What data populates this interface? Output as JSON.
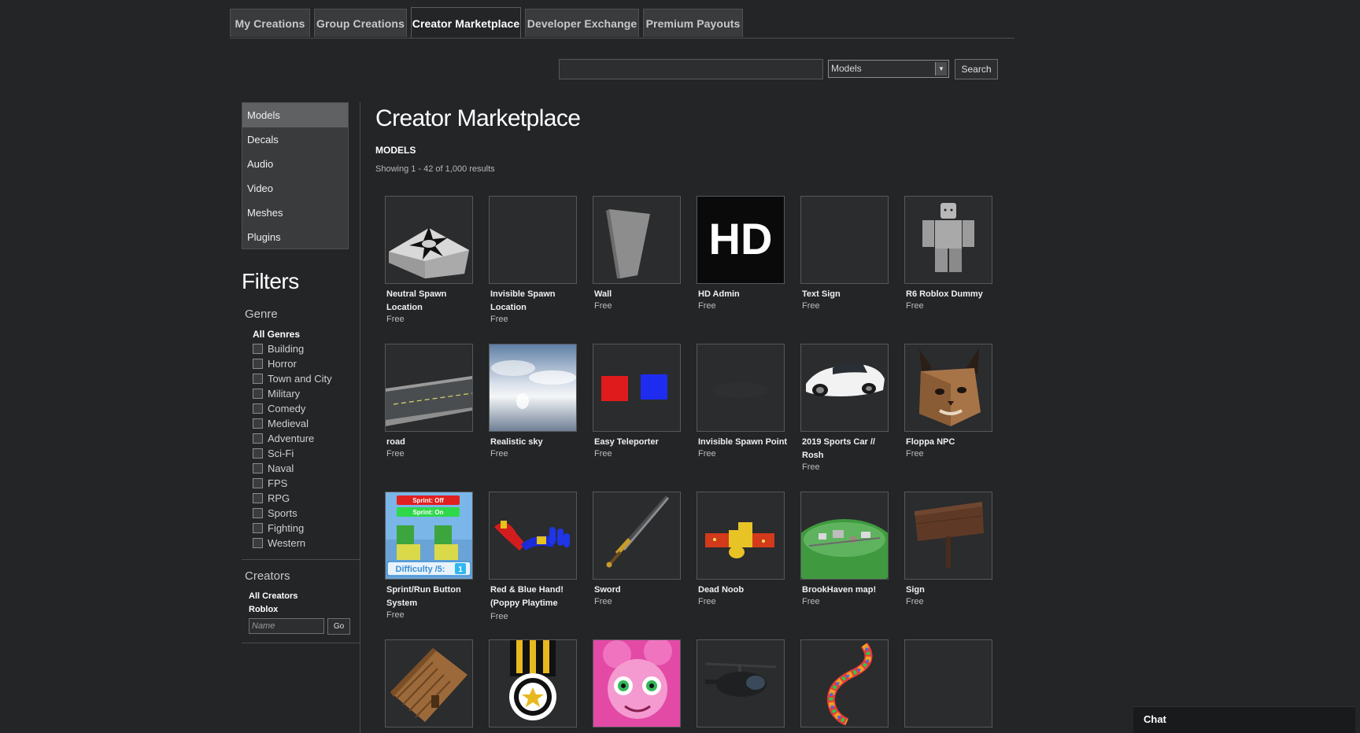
{
  "tabs": [
    {
      "label": "My Creations",
      "active": false
    },
    {
      "label": "Group Creations",
      "active": false
    },
    {
      "label": "Creator Marketplace",
      "active": true
    },
    {
      "label": "Developer Exchange",
      "active": false
    },
    {
      "label": "Premium Payouts",
      "active": false
    }
  ],
  "search": {
    "query": "",
    "category_selected": "Models",
    "button_label": "Search"
  },
  "categories": [
    {
      "label": "Models",
      "active": true
    },
    {
      "label": "Decals",
      "active": false
    },
    {
      "label": "Audio",
      "active": false
    },
    {
      "label": "Video",
      "active": false
    },
    {
      "label": "Meshes",
      "active": false
    },
    {
      "label": "Plugins",
      "active": false
    }
  ],
  "filters": {
    "title": "Filters",
    "genre_title": "Genre",
    "all_genres_label": "All Genres",
    "genres": [
      "Building",
      "Horror",
      "Town and City",
      "Military",
      "Comedy",
      "Medieval",
      "Adventure",
      "Sci-Fi",
      "Naval",
      "FPS",
      "RPG",
      "Sports",
      "Fighting",
      "Western"
    ],
    "creators_title": "Creators",
    "all_creators_label": "All Creators",
    "creator_roblox": "Roblox",
    "name_placeholder": "Name",
    "go_label": "Go"
  },
  "main": {
    "title": "Creator Marketplace",
    "section_label": "MODELS",
    "results_text": "Showing 1 - 42 of 1,000 results"
  },
  "items": [
    {
      "name": "Neutral Spawn Location",
      "price": "Free",
      "thumb": "spawn-pad"
    },
    {
      "name": "Invisible Spawn Location",
      "price": "Free",
      "thumb": "empty"
    },
    {
      "name": "Wall",
      "price": "Free",
      "thumb": "wall"
    },
    {
      "name": "HD Admin",
      "price": "Free",
      "thumb": "hd-logo",
      "thumb_text": "HD"
    },
    {
      "name": "Text Sign",
      "price": "Free",
      "thumb": "empty"
    },
    {
      "name": "R6 Roblox Dummy",
      "price": "Free",
      "thumb": "dummy"
    },
    {
      "name": "road",
      "price": "Free",
      "thumb": "road"
    },
    {
      "name": "Realistic sky",
      "price": "Free",
      "thumb": "sky"
    },
    {
      "name": "Easy Teleporter",
      "price": "Free",
      "thumb": "teleporter"
    },
    {
      "name": "Invisible Spawn Point",
      "price": "Free",
      "thumb": "empty-dark"
    },
    {
      "name": "2019 Sports Car // Rosh",
      "price": "Free",
      "thumb": "sports-car"
    },
    {
      "name": "Floppa NPC",
      "price": "Free",
      "thumb": "floppa"
    },
    {
      "name": "Sprint/Run Button System",
      "price": "Free",
      "thumb": "sprint",
      "thumb_text": [
        "Sprint: Off",
        "Sprint: On",
        "Difficulty /5:",
        "1"
      ]
    },
    {
      "name": "Red & Blue Hand! (Poppy Playtime",
      "price": "Free",
      "thumb": "hands"
    },
    {
      "name": "Sword",
      "price": "Free",
      "thumb": "sword"
    },
    {
      "name": "Dead Noob",
      "price": "Free",
      "thumb": "dead-noob"
    },
    {
      "name": "BrookHaven map!",
      "price": "Free",
      "thumb": "map"
    },
    {
      "name": "Sign",
      "price": "Free",
      "thumb": "wood-sign"
    },
    {
      "name": "",
      "price": "",
      "thumb": "cabin"
    },
    {
      "name": "",
      "price": "",
      "thumb": "medal"
    },
    {
      "name": "",
      "price": "",
      "thumb": "mommy"
    },
    {
      "name": "",
      "price": "",
      "thumb": "helicopter"
    },
    {
      "name": "",
      "price": "",
      "thumb": "rainbow"
    },
    {
      "name": "",
      "price": "",
      "thumb": "empty"
    }
  ],
  "chat": {
    "label": "Chat"
  },
  "colors": {
    "background": "#232527",
    "tab_bg": "#393b3d",
    "active_category": "#5f6163",
    "text_primary": "#ffffff",
    "text_muted": "#bdbdbd"
  }
}
